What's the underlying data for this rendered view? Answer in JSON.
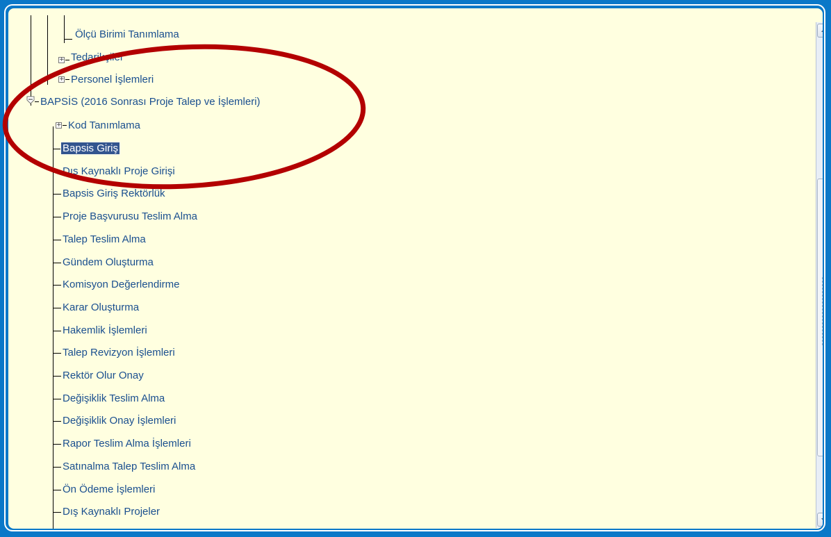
{
  "tree": {
    "items": [
      {
        "label": "Ölçü Birimi Tanımlama"
      },
      {
        "label": "Tedarikçiler"
      },
      {
        "label": "Personel İşlemleri"
      },
      {
        "label": "BAPSİS (2016 Sonrası Proje Talep ve İşlemleri)"
      },
      {
        "label": "Kod Tanımlama"
      },
      {
        "label": "Bapsis Giriş"
      },
      {
        "label": "Dış Kaynaklı Proje Girişi"
      },
      {
        "label": "Bapsis Giriş Rektörlük"
      },
      {
        "label": "Proje Başvurusu Teslim Alma"
      },
      {
        "label": "Talep Teslim Alma"
      },
      {
        "label": "Gündem Oluşturma"
      },
      {
        "label": "Komisyon Değerlendirme"
      },
      {
        "label": "Karar Oluşturma"
      },
      {
        "label": "Hakemlik İşlemleri"
      },
      {
        "label": "Talep Revizyon İşlemleri"
      },
      {
        "label": "Rektör Olur Onay"
      },
      {
        "label": "Değişiklik Teslim Alma"
      },
      {
        "label": "Değişiklik Onay İşlemleri"
      },
      {
        "label": "Rapor Teslim Alma İşlemleri"
      },
      {
        "label": "Satınalma Talep Teslim Alma"
      },
      {
        "label": "Ön Ödeme İşlemleri"
      },
      {
        "label": "Dış Kaynaklı Projeler"
      }
    ],
    "selected": "Bapsis Giriş",
    "expanded": [
      "BAPSİS (2016 Sonrası Proje Talep ve İşlemleri)"
    ],
    "collapsed": [
      "Tedarikçiler",
      "Personel İşlemleri",
      "Kod Tanımlama"
    ]
  },
  "colors": {
    "frame": "#0a78c8",
    "panel": "#ffffe0",
    "text": "#1a4f8f",
    "selection": "#33558f",
    "annotation": "#b30000"
  },
  "icons": {
    "expand": "plus-box-icon",
    "collapse": "minus-shield-icon"
  }
}
